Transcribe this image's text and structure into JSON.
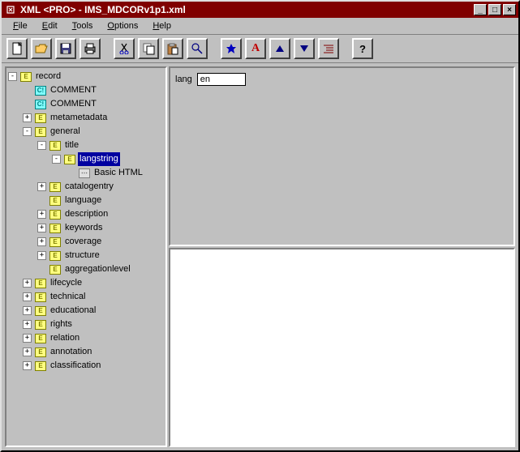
{
  "title": "XML <PRO> - IMS_MDCORv1p1.xml",
  "menu": {
    "file": "File",
    "edit": "Edit",
    "tools": "Tools",
    "options": "Options",
    "help": "Help"
  },
  "toolbar": {
    "new": "📄",
    "open": "📂",
    "save": "💾",
    "print": "🖶",
    "cut": "✂",
    "copy": "📋",
    "paste": "📄",
    "find": "🔍",
    "validate": "✶",
    "wellformed": "A",
    "up": "▲",
    "down": "▼",
    "indent": "≡",
    "help": "?"
  },
  "attr": {
    "lang_label": "lang",
    "lang_value": "en"
  },
  "tree": {
    "record": "record",
    "comment": "COMMENT",
    "metametadata": "metametadata",
    "general": "general",
    "title": "title",
    "langstring": "langstring",
    "basichtml": "Basic HTML",
    "catalogentry": "catalogentry",
    "language": "language",
    "description": "description",
    "keywords": "keywords",
    "coverage": "coverage",
    "structure": "structure",
    "aggregationlevel": "aggregationlevel",
    "lifecycle": "lifecycle",
    "technical": "technical",
    "educational": "educational",
    "rights": "rights",
    "relation": "relation",
    "annotation": "annotation",
    "classification": "classification"
  }
}
